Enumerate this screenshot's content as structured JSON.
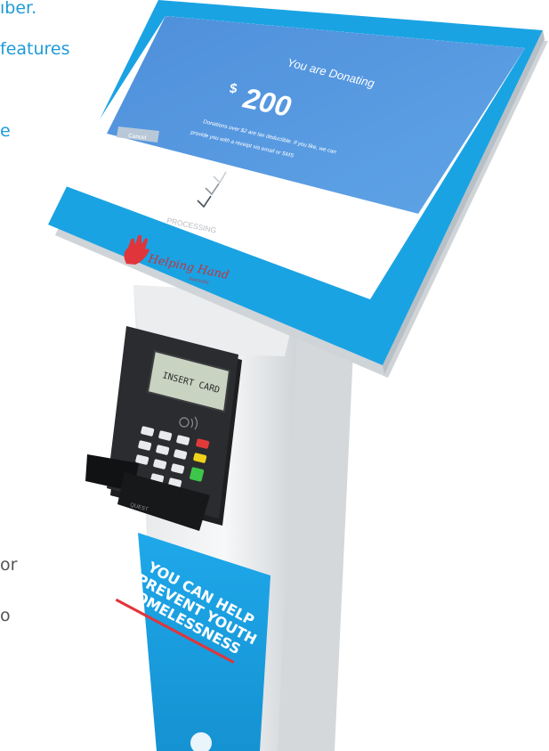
{
  "page": {
    "cropped_text": [
      "ıber.",
      "features",
      "e",
      "or",
      "o"
    ]
  },
  "kiosk": {
    "screen": {
      "title": "You are Donating",
      "currency": "$",
      "amount": "200",
      "note_line1": "Donations over $2 are tax deductible. If you like, we can",
      "note_line2": "provide you with a receipt via email or SMS",
      "cancel_label": "Cancel",
      "status": "PROCESSING"
    },
    "brand": {
      "name": "Helping Hand",
      "sub": "Australia"
    },
    "card_reader": {
      "display_text": "INSERT CARD",
      "slot_label": "QUEST"
    },
    "poster": {
      "line1": "YOU CAN HELP",
      "line2": "PREVENT YOUTH",
      "line3": "HOMELESSNESS"
    }
  },
  "colors": {
    "kiosk_blue": "#1aa3e3",
    "screen_blue": "#4d93df",
    "text_blue": "#1e9bd7",
    "poster_red": "#e0353b"
  }
}
